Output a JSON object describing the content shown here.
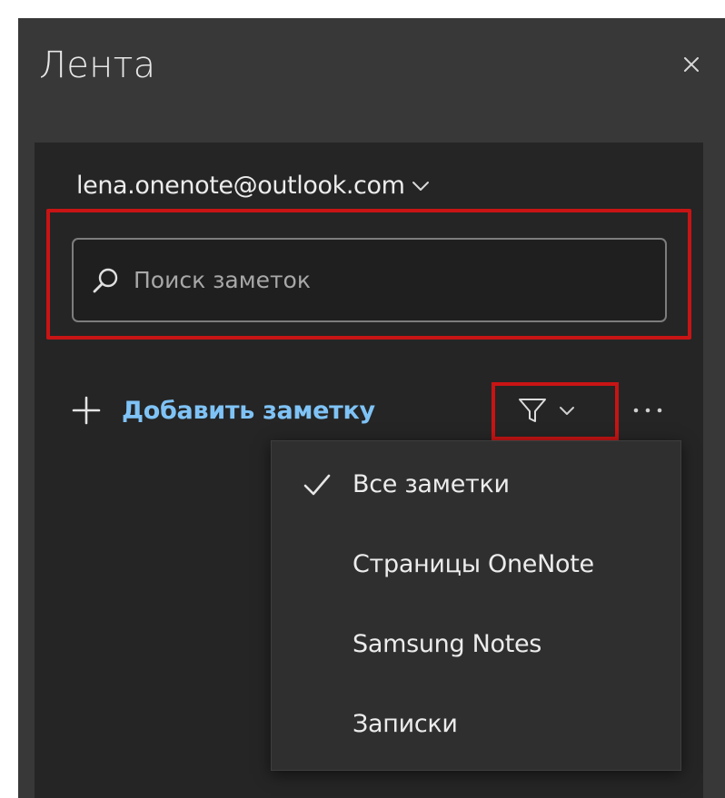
{
  "header": {
    "title": "Лента"
  },
  "account": {
    "email": "lena.onenote@outlook.com"
  },
  "search": {
    "placeholder": "Поиск заметок"
  },
  "toolbar": {
    "add_note_label": "Добавить заметку"
  },
  "filter_menu": {
    "items": [
      {
        "label": "Все заметки",
        "checked": true
      },
      {
        "label": "Страницы OneNote",
        "checked": false
      },
      {
        "label": "Samsung Notes",
        "checked": false
      },
      {
        "label": "Записки",
        "checked": false
      }
    ]
  },
  "colors": {
    "background": "#383838",
    "panel": "#252525",
    "menu": "#2f2f2f",
    "accent": "#7fc3f6",
    "highlight": "#c81414"
  }
}
